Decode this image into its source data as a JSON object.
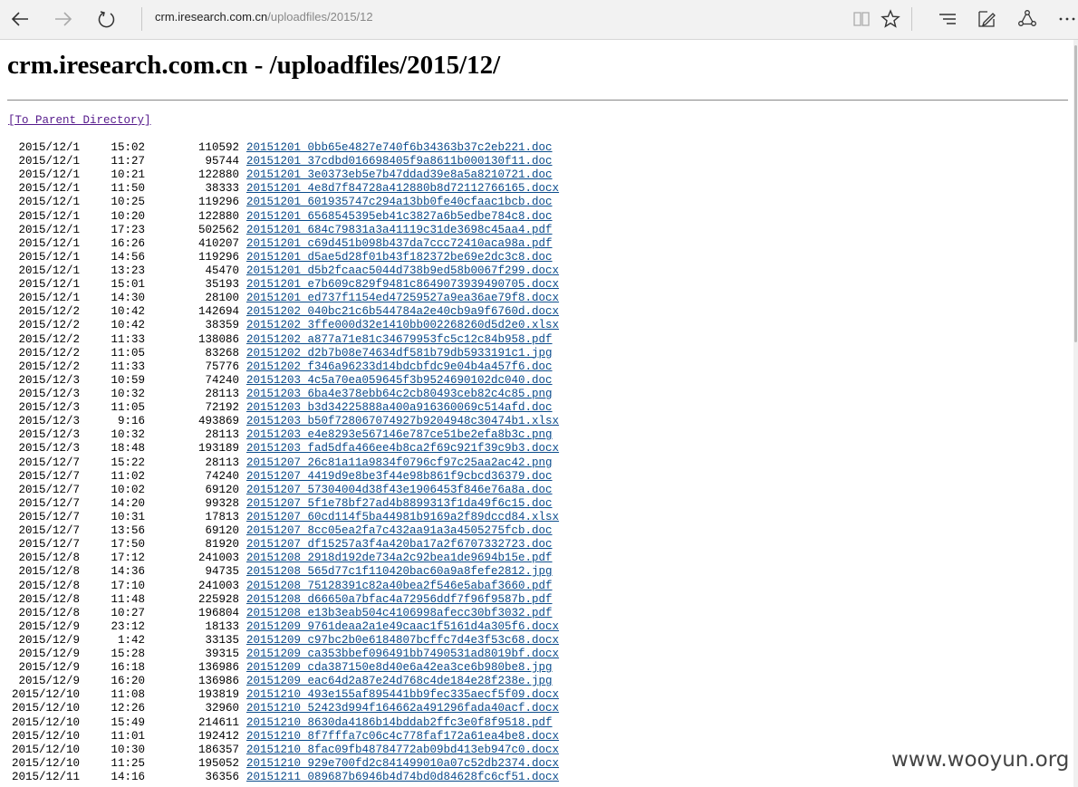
{
  "browser": {
    "address_host": "crm.iresearch.com.cn",
    "address_path": "/uploadfiles/2015/12"
  },
  "page": {
    "title": "crm.iresearch.com.cn - /uploadfiles/2015/12/",
    "parent_link": "[To Parent Directory]",
    "files": [
      {
        "date": "2015/12/1",
        "time": "15:02",
        "size": "110592",
        "name": "20151201_0bb65e4827e740f6b34363b37c2eb221.doc"
      },
      {
        "date": "2015/12/1",
        "time": "11:27",
        "size": "95744",
        "name": "20151201_37cdbd016698405f9a8611b000130f11.doc"
      },
      {
        "date": "2015/12/1",
        "time": "10:21",
        "size": "122880",
        "name": "20151201_3e0373eb5e7b47ddad39e8a5a8210721.doc"
      },
      {
        "date": "2015/12/1",
        "time": "11:50",
        "size": "38333",
        "name": "20151201_4e8d7f84728a412880b8d72112766165.docx"
      },
      {
        "date": "2015/12/1",
        "time": "10:25",
        "size": "119296",
        "name": "20151201_601935747c294a13bb0fe40cfaac1bcb.doc"
      },
      {
        "date": "2015/12/1",
        "time": "10:20",
        "size": "122880",
        "name": "20151201_6568545395eb41c3827a6b5edbe784c8.doc"
      },
      {
        "date": "2015/12/1",
        "time": "17:23",
        "size": "502562",
        "name": "20151201_684c79831a3a41119c31de3698c45aa4.pdf"
      },
      {
        "date": "2015/12/1",
        "time": "16:26",
        "size": "410207",
        "name": "20151201_c69d451b098b437da7ccc72410aca98a.pdf"
      },
      {
        "date": "2015/12/1",
        "time": "14:56",
        "size": "119296",
        "name": "20151201_d5ae5d28f01b43f182372be69e2dc3c8.doc"
      },
      {
        "date": "2015/12/1",
        "time": "13:23",
        "size": "45470",
        "name": "20151201_d5b2fcaac5044d738b9ed58b0067f299.docx"
      },
      {
        "date": "2015/12/1",
        "time": "15:01",
        "size": "35193",
        "name": "20151201_e7b609c829f9481c8649073939490705.docx"
      },
      {
        "date": "2015/12/1",
        "time": "14:30",
        "size": "28100",
        "name": "20151201_ed737f1154ed47259527a9ea36ae79f8.docx"
      },
      {
        "date": "2015/12/2",
        "time": "10:42",
        "size": "142694",
        "name": "20151202_040bc21c6b544784a2e40cb9a9f6760d.docx"
      },
      {
        "date": "2015/12/2",
        "time": "10:42",
        "size": "38359",
        "name": "20151202_3ffe000d32e1410bb002268260d5d2e0.xlsx"
      },
      {
        "date": "2015/12/2",
        "time": "11:33",
        "size": "138086",
        "name": "20151202_a877a71e81c34679953fc5c12c84b958.pdf"
      },
      {
        "date": "2015/12/2",
        "time": "11:05",
        "size": "83268",
        "name": "20151202_d2b7b08e74634df581b79db5933191c1.jpg"
      },
      {
        "date": "2015/12/2",
        "time": "11:33",
        "size": "75776",
        "name": "20151202_f346a96233d14bdcbfdc9e04b4a457f6.doc"
      },
      {
        "date": "2015/12/3",
        "time": "10:59",
        "size": "74240",
        "name": "20151203_4c5a70ea059645f3b9524690102dc040.doc"
      },
      {
        "date": "2015/12/3",
        "time": "10:32",
        "size": "28113",
        "name": "20151203_6ba4e378ebb64c2cb80493ceb82c4c85.png"
      },
      {
        "date": "2015/12/3",
        "time": "11:05",
        "size": "72192",
        "name": "20151203_b3d34225888a400a916360069c514afd.doc"
      },
      {
        "date": "2015/12/3",
        "time": "9:16",
        "size": "493869",
        "name": "20151203_b50f728067074927b9204948c30474b1.xlsx"
      },
      {
        "date": "2015/12/3",
        "time": "10:32",
        "size": "28113",
        "name": "20151203_e4e8293e567146e787ce51be2efa8b3c.png"
      },
      {
        "date": "2015/12/3",
        "time": "18:48",
        "size": "193189",
        "name": "20151203_fad5dfa466ee4b8ca2f69c921f39c9b3.docx"
      },
      {
        "date": "2015/12/7",
        "time": "15:22",
        "size": "28113",
        "name": "20151207_26c81a11a9834f0796cf97c25aa2ac42.png"
      },
      {
        "date": "2015/12/7",
        "time": "11:02",
        "size": "74240",
        "name": "20151207_4419d9e8be3f44e98b861f9cbcd36379.doc"
      },
      {
        "date": "2015/12/7",
        "time": "10:02",
        "size": "69120",
        "name": "20151207_57304004d38f43e1906453f846e76a8a.doc"
      },
      {
        "date": "2015/12/7",
        "time": "14:20",
        "size": "99328",
        "name": "20151207_5f1e78bf27ad4b8899313f1da49f6c15.doc"
      },
      {
        "date": "2015/12/7",
        "time": "10:31",
        "size": "17813",
        "name": "20151207_60cd114f5ba44981b9169a2f89dccd84.xlsx"
      },
      {
        "date": "2015/12/7",
        "time": "13:56",
        "size": "69120",
        "name": "20151207_8cc05ea2fa7c432aa91a3a4505275fcb.doc"
      },
      {
        "date": "2015/12/7",
        "time": "17:50",
        "size": "81920",
        "name": "20151207_df15257a3f4a420ba17a2f6707332723.doc"
      },
      {
        "date": "2015/12/8",
        "time": "17:12",
        "size": "241003",
        "name": "20151208_2918d192de734a2c92bea1de9694b15e.pdf"
      },
      {
        "date": "2015/12/8",
        "time": "14:36",
        "size": "94735",
        "name": "20151208_565d77c1f110420bac60a9a8fefe2812.jpg"
      },
      {
        "date": "2015/12/8",
        "time": "17:10",
        "size": "241003",
        "name": "20151208_75128391c82a40bea2f546e5abaf3660.pdf"
      },
      {
        "date": "2015/12/8",
        "time": "11:48",
        "size": "225928",
        "name": "20151208_d66650a7bfac4a72956ddf7f96f9587b.pdf"
      },
      {
        "date": "2015/12/8",
        "time": "10:27",
        "size": "196804",
        "name": "20151208_e13b3eab504c4106998afecc30bf3032.pdf"
      },
      {
        "date": "2015/12/9",
        "time": "23:12",
        "size": "18133",
        "name": "20151209_9761deaa2a1e49caac1f5161d4a305f6.docx"
      },
      {
        "date": "2015/12/9",
        "time": "1:42",
        "size": "33135",
        "name": "20151209_c97bc2b0e6184807bcffc7d4e3f53c68.docx"
      },
      {
        "date": "2015/12/9",
        "time": "15:28",
        "size": "39315",
        "name": "20151209_ca353bbef096491bb7490531ad8019bf.docx"
      },
      {
        "date": "2015/12/9",
        "time": "16:18",
        "size": "136986",
        "name": "20151209_cda387150e8d40e6a42ea3ce6b980be8.jpg"
      },
      {
        "date": "2015/12/9",
        "time": "16:20",
        "size": "136986",
        "name": "20151209_eac64d2a87e24d768c4de184e28f238e.jpg"
      },
      {
        "date": "2015/12/10",
        "time": "11:08",
        "size": "193819",
        "name": "20151210_493e155af895441bb9fec335aecf5f09.docx"
      },
      {
        "date": "2015/12/10",
        "time": "12:26",
        "size": "32960",
        "name": "20151210_52423d994f164662a491296fada40acf.docx"
      },
      {
        "date": "2015/12/10",
        "time": "15:49",
        "size": "214611",
        "name": "20151210_8630da4186b14bddab2ffc3e0f8f9518.pdf"
      },
      {
        "date": "2015/12/10",
        "time": "11:01",
        "size": "192412",
        "name": "20151210_8f7fffa7c06c4c778faf172a61ea4be8.docx"
      },
      {
        "date": "2015/12/10",
        "time": "10:30",
        "size": "186357",
        "name": "20151210_8fac09fb48784772ab09bd413eb947c0.docx"
      },
      {
        "date": "2015/12/10",
        "time": "11:25",
        "size": "195052",
        "name": "20151210_929e700fd2c841499010a07c52db2374.docx"
      },
      {
        "date": "2015/12/11",
        "time": "14:16",
        "size": "36356",
        "name": "20151211_089687b6946b4d74bd0d84628fc6cf51.docx"
      }
    ]
  },
  "watermark": "www.wooyun.org"
}
